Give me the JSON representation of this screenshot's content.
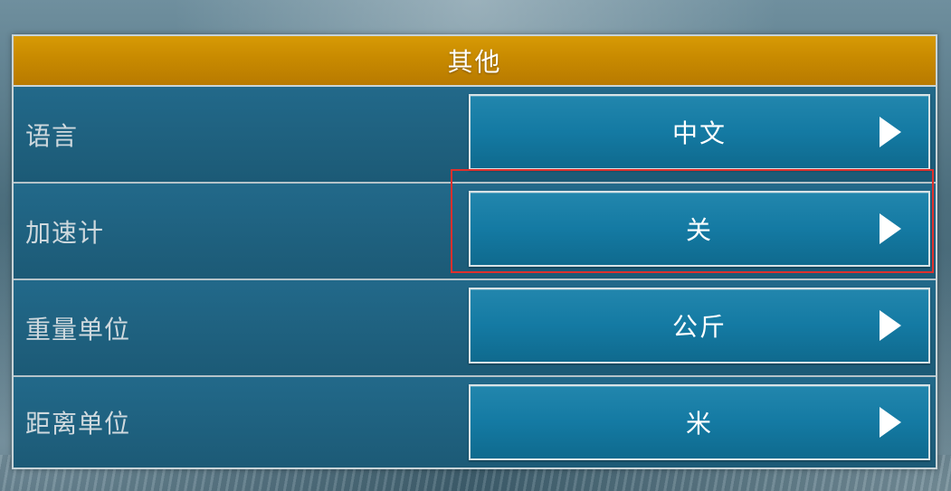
{
  "header": {
    "title": "其他"
  },
  "settings": [
    {
      "label": "语言",
      "value": "中文"
    },
    {
      "label": "加速计",
      "value": "关"
    },
    {
      "label": "重量单位",
      "value": "公斤"
    },
    {
      "label": "距离单位",
      "value": "米"
    }
  ],
  "icons": {
    "next": "chevron-right-icon"
  },
  "colors": {
    "header": "#c88a00",
    "panel": "#1f5f7a",
    "button": "#147aa3",
    "highlight": "#e0302c"
  }
}
